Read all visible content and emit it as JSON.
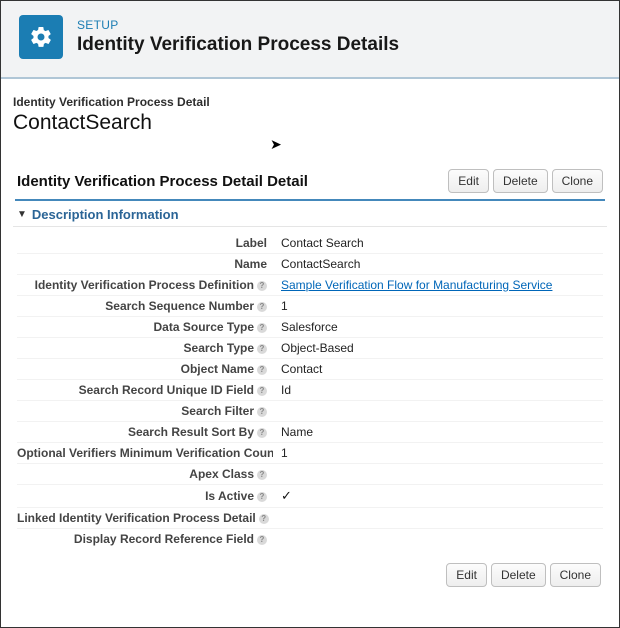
{
  "header": {
    "crumb": "SETUP",
    "title": "Identity Verification Process Details"
  },
  "page": {
    "crumb": "Identity Verification Process Detail",
    "record_title": "ContactSearch",
    "section_title": "Identity Verification Process Detail Detail"
  },
  "buttons": {
    "edit": "Edit",
    "delete": "Delete",
    "clone": "Clone"
  },
  "desc_heading": "Description Information",
  "fields": {
    "label": {
      "label": "Label",
      "value": "Contact Search"
    },
    "name": {
      "label": "Name",
      "value": "ContactSearch"
    },
    "definition": {
      "label": "Identity Verification Process Definition",
      "value": "Sample Verification Flow for Manufacturing Service"
    },
    "sequence": {
      "label": "Search Sequence Number",
      "value": "1"
    },
    "dstype": {
      "label": "Data Source Type",
      "value": "Salesforce"
    },
    "stype": {
      "label": "Search Type",
      "value": "Object-Based"
    },
    "objname": {
      "label": "Object Name",
      "value": "Contact"
    },
    "uid": {
      "label": "Search Record Unique ID Field",
      "value": "Id"
    },
    "filter": {
      "label": "Search Filter",
      "value": ""
    },
    "sortby": {
      "label": "Search Result Sort By",
      "value": "Name"
    },
    "minver": {
      "label": "Optional Verifiers Minimum Verification Count",
      "value": "1"
    },
    "apex": {
      "label": "Apex Class",
      "value": ""
    },
    "active": {
      "label": "Is Active",
      "value": "✓"
    },
    "linked": {
      "label": "Linked Identity Verification Process Detail",
      "value": ""
    },
    "dispref": {
      "label": "Display Record Reference Field",
      "value": ""
    }
  }
}
